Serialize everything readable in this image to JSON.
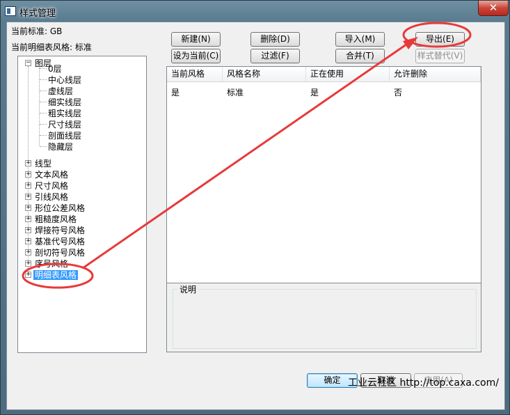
{
  "window": {
    "title": "样式管理",
    "close_glyph": "✕"
  },
  "info": {
    "standard": "当前标准: GB",
    "detail_style": "当前明细表风格: 标准"
  },
  "tree": {
    "layer_root": "图层",
    "layers": [
      "0层",
      "中心线层",
      "虚线层",
      "细实线层",
      "粗实线层",
      "尺寸线层",
      "剖面线层",
      "隐藏层"
    ],
    "groups": [
      "线型",
      "文本风格",
      "尺寸风格",
      "引线风格",
      "形位公差风格",
      "粗糙度风格",
      "焊接符号风格",
      "基准代号风格",
      "剖切符号风格",
      "序号风格",
      "明细表风格"
    ],
    "expand_minus": "−",
    "expand_plus": "+"
  },
  "toolbar": {
    "new": "新建(N)",
    "delete": "删除(D)",
    "import": "导入(M)",
    "export": "导出(E)",
    "set_current": "设为当前(C)",
    "filter": "过滤(F)",
    "merge": "合并(T)",
    "replace": "样式替代(V)"
  },
  "table": {
    "headers": [
      "当前风格",
      "风格名称",
      "正在使用",
      "允许删除"
    ],
    "rows": [
      [
        "是",
        "标准",
        "是",
        "否"
      ]
    ]
  },
  "description": {
    "label": "说明"
  },
  "actions": {
    "ok": "确定",
    "cancel": "取消",
    "apply": "应用(A)"
  },
  "watermark": "工业云社区 http://top.caxa.com/",
  "colors": {
    "annotation": "#e8393a",
    "selection": "#3399ff"
  }
}
